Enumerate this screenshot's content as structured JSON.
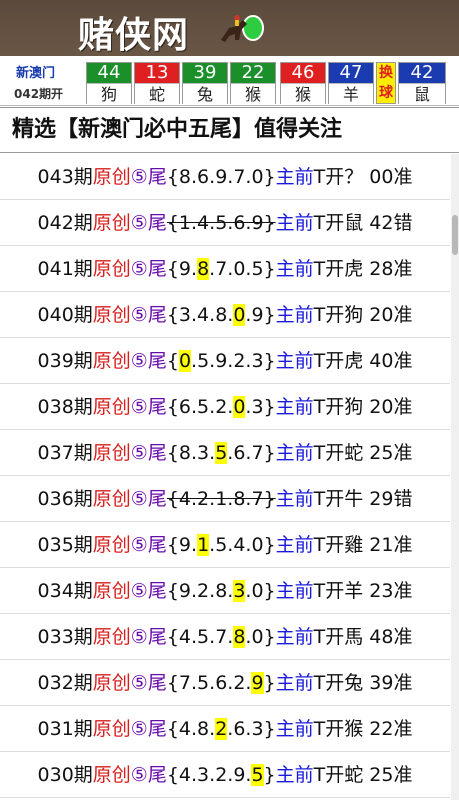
{
  "header": {
    "site_name": "赌侠网"
  },
  "results": {
    "region": "新澳门",
    "issue": "042期开",
    "balls": [
      {
        "number": "44",
        "zodiac": "狗",
        "color": "#1a8f2a"
      },
      {
        "number": "13",
        "zodiac": "蛇",
        "color": "#e02020"
      },
      {
        "number": "39",
        "zodiac": "兔",
        "color": "#1a8f2a"
      },
      {
        "number": "22",
        "zodiac": "猴",
        "color": "#1a8f2a"
      },
      {
        "number": "46",
        "zodiac": "猴",
        "color": "#e02020"
      },
      {
        "number": "47",
        "zodiac": "羊",
        "color": "#1a3cb0"
      }
    ],
    "swap_label": "换球",
    "special": {
      "number": "42",
      "zodiac": "鼠",
      "color": "#1a3cb0"
    }
  },
  "section": {
    "title": "精选【新澳门必中五尾】值得关注"
  },
  "rows": [
    {
      "issue": "043期",
      "tag": "原创",
      "five": "⑤尾",
      "pre": "{8.6.9.7.0}",
      "hl": "",
      "post": "",
      "strike": false,
      "main": "主前",
      "result": "T开？ 00准"
    },
    {
      "issue": "042期",
      "tag": "原创",
      "five": "⑤尾",
      "pre": "{1.4.5.6.9}",
      "hl": "",
      "post": "",
      "strike": true,
      "main": "主前",
      "result": "T开鼠 42错"
    },
    {
      "issue": "041期",
      "tag": "原创",
      "five": "⑤尾",
      "pre": "{9.",
      "hl": "8",
      "post": ".7.0.5}",
      "strike": false,
      "main": "主前",
      "result": "T开虎 28准"
    },
    {
      "issue": "040期",
      "tag": "原创",
      "five": "⑤尾",
      "pre": "{3.4.8.",
      "hl": "0",
      "post": ".9}",
      "strike": false,
      "main": "主前",
      "result": "T开狗 20准"
    },
    {
      "issue": "039期",
      "tag": "原创",
      "five": "⑤尾",
      "pre": "{",
      "hl": "0",
      "post": ".5.9.2.3}",
      "strike": false,
      "main": "主前",
      "result": "T开虎 40准"
    },
    {
      "issue": "038期",
      "tag": "原创",
      "five": "⑤尾",
      "pre": "{6.5.2.",
      "hl": "0",
      "post": ".3}",
      "strike": false,
      "main": "主前",
      "result": "T开狗 20准"
    },
    {
      "issue": "037期",
      "tag": "原创",
      "five": "⑤尾",
      "pre": "{8.3.",
      "hl": "5",
      "post": ".6.7}",
      "strike": false,
      "main": "主前",
      "result": "T开蛇 25准"
    },
    {
      "issue": "036期",
      "tag": "原创",
      "five": "⑤尾",
      "pre": "{4.2.1.8.7}",
      "hl": "",
      "post": "",
      "strike": true,
      "main": "主前",
      "result": "T开牛 29错"
    },
    {
      "issue": "035期",
      "tag": "原创",
      "five": "⑤尾",
      "pre": "{9.",
      "hl": "1",
      "post": ".5.4.0}",
      "strike": false,
      "main": "主前",
      "result": "T开雞 21准"
    },
    {
      "issue": "034期",
      "tag": "原创",
      "five": "⑤尾",
      "pre": "{9.2.8.",
      "hl": "3",
      "post": ".0}",
      "strike": false,
      "main": "主前",
      "result": "T开羊 23准"
    },
    {
      "issue": "033期",
      "tag": "原创",
      "five": "⑤尾",
      "pre": "{4.5.7.",
      "hl": "8",
      "post": ".0}",
      "strike": false,
      "main": "主前",
      "result": "T开馬 48准"
    },
    {
      "issue": "032期",
      "tag": "原创",
      "five": "⑤尾",
      "pre": "{7.5.6.2.",
      "hl": "9",
      "post": "}",
      "strike": false,
      "main": "主前",
      "result": "T开兔 39准"
    },
    {
      "issue": "031期",
      "tag": "原创",
      "five": "⑤尾",
      "pre": "{4.8.",
      "hl": "2",
      "post": ".6.3}",
      "strike": false,
      "main": "主前",
      "result": "T开猴 22准"
    },
    {
      "issue": "030期",
      "tag": "原创",
      "five": "⑤尾",
      "pre": "{4.3.2.9.",
      "hl": "5",
      "post": "}",
      "strike": false,
      "main": "主前",
      "result": "T开蛇 25准"
    }
  ]
}
